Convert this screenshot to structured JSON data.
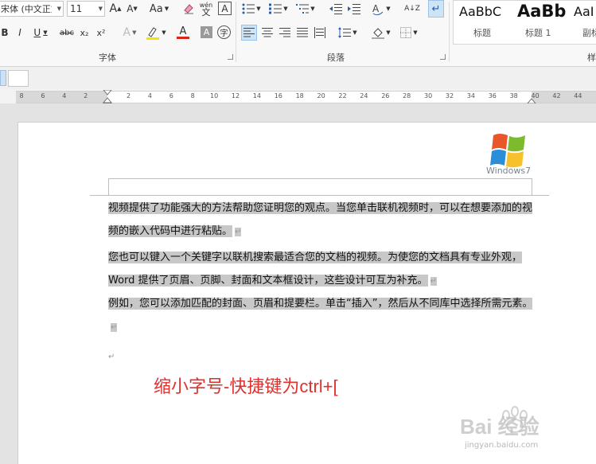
{
  "ribbon": {
    "font_name": "宋体 (中文正文",
    "font_size": "11",
    "bold": "B",
    "italic": "I",
    "underline": "U",
    "strike": "abc",
    "sub": "x₂",
    "sup": "x²",
    "grow_font": "A",
    "shrink_font": "A",
    "change_case": "Aa",
    "phonetic_top": "wén",
    "phonetic_bottom": "文",
    "char_border": "A",
    "font_color_label": "A",
    "text_effect": "A",
    "char_shading": "A",
    "enclose": "字",
    "font_group_label": "字体",
    "para_group_label": "段落",
    "sort": "A↓Z",
    "styles": [
      {
        "preview": "AaBbC",
        "name": "标题"
      },
      {
        "preview": "AaBb",
        "name": "标题 1"
      },
      {
        "preview": "AaI",
        "name": "副标"
      }
    ],
    "styles_group_label": "样",
    "highlight_color": "#f5e400",
    "font_color": "#d9261c"
  },
  "ruler": {
    "labels": [
      "8",
      "6",
      "4",
      "2",
      "2",
      "4",
      "6",
      "8",
      "10",
      "12",
      "14",
      "16",
      "18",
      "20",
      "22",
      "24",
      "26",
      "28",
      "30",
      "32",
      "34",
      "36",
      "38",
      "40",
      "42",
      "44"
    ]
  },
  "document": {
    "logo_text": "Windows7",
    "para1": "视频提供了功能强大的方法帮助您证明您的观点。当您单击联机视频时，可以在想要添加的视频的嵌入代码中进行粘贴。",
    "para2": "您也可以键入一个关键字以联机搜索最适合您的文档的视频。为使您的文档具有专业外观，Word 提供了页眉、页脚、封面和文本框设计，这些设计可互为补充。",
    "para3": "例如，您可以添加匹配的封面、页眉和提要栏。单击“插入”，然后从不同库中选择所需元素。",
    "para_mark": "↵",
    "caption": "缩小字号-快捷键为ctrl+[",
    "watermark_main": "Bai 经验",
    "watermark_url": "jingyan.baidu.com"
  }
}
